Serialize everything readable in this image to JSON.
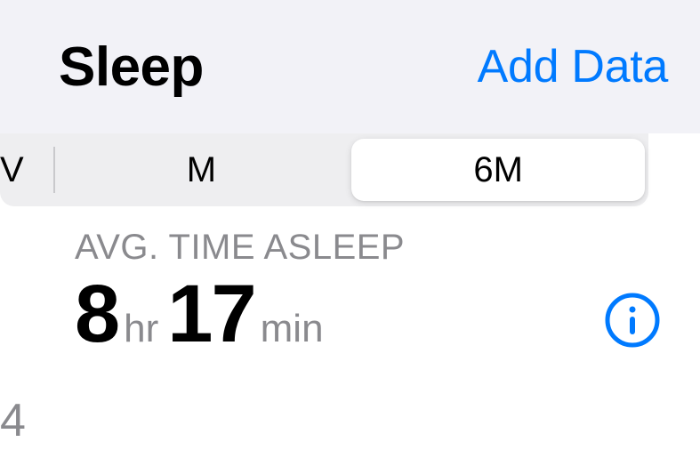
{
  "header": {
    "title": "Sleep",
    "action_label": "Add Data"
  },
  "segments": {
    "partial_left_label": "V",
    "month_label": "M",
    "six_month_label": "6M"
  },
  "summary": {
    "label": "AVG. TIME ASLEEP",
    "hours_value": "8",
    "hours_unit": "hr",
    "minutes_value": "17",
    "minutes_unit": "min"
  },
  "edge": {
    "partial_char": "4"
  },
  "colors": {
    "accent": "#007aff"
  }
}
